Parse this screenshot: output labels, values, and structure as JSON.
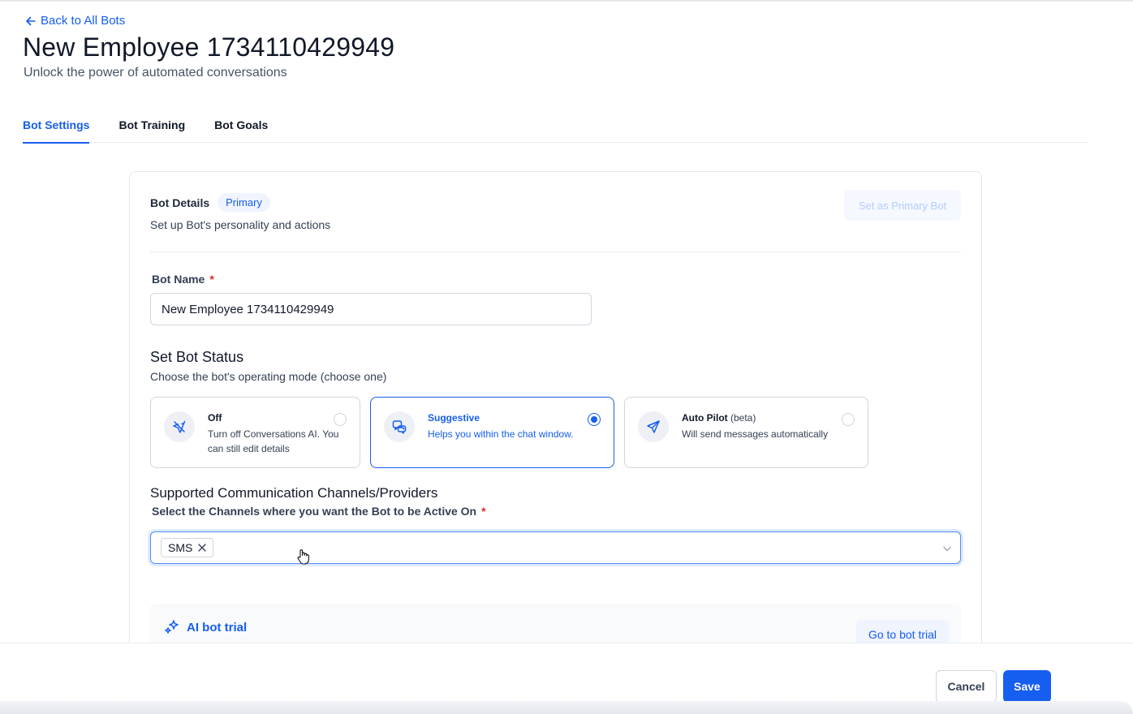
{
  "nav": {
    "back_label": "Back to All Bots"
  },
  "header": {
    "title": "New Employee 1734110429949",
    "subtitle": "Unlock the power of automated conversations"
  },
  "tabs": [
    {
      "label": "Bot Settings",
      "active": true
    },
    {
      "label": "Bot Training",
      "active": false
    },
    {
      "label": "Bot Goals",
      "active": false
    }
  ],
  "card": {
    "title": "Bot Details",
    "badge": "Primary",
    "subtitle": "Set up Bot's personality and actions",
    "primary_button": "Set as Primary Bot"
  },
  "bot_name": {
    "label": "Bot Name",
    "required_mark": "*",
    "value": "New Employee 1734110429949"
  },
  "status": {
    "title": "Set Bot Status",
    "subtitle": "Choose the bot's operating mode (choose one)",
    "options": [
      {
        "title": "Off",
        "suffix": "",
        "desc": "Turn off Conversations AI. You can still edit details",
        "icon": "no-send-icon",
        "selected": false
      },
      {
        "title": "Suggestive",
        "suffix": "",
        "desc": "Helps you within the chat window.",
        "icon": "chat-bubbles-icon",
        "selected": true
      },
      {
        "title": "Auto Pilot",
        "suffix": "(beta)",
        "desc": "Will send messages automatically",
        "icon": "send-icon",
        "selected": false
      }
    ]
  },
  "channels": {
    "title": "Supported Communication Channels/Providers",
    "label": "Select the Channels where you want the Bot to be Active On",
    "required_mark": "*",
    "selected": [
      "SMS"
    ]
  },
  "trial": {
    "label": "AI bot trial",
    "button": "Go to bot trial"
  },
  "footer": {
    "cancel": "Cancel",
    "save": "Save"
  },
  "colors": {
    "accent": "#155eef",
    "border": "#d0d5dd",
    "required": "#d92d20"
  }
}
